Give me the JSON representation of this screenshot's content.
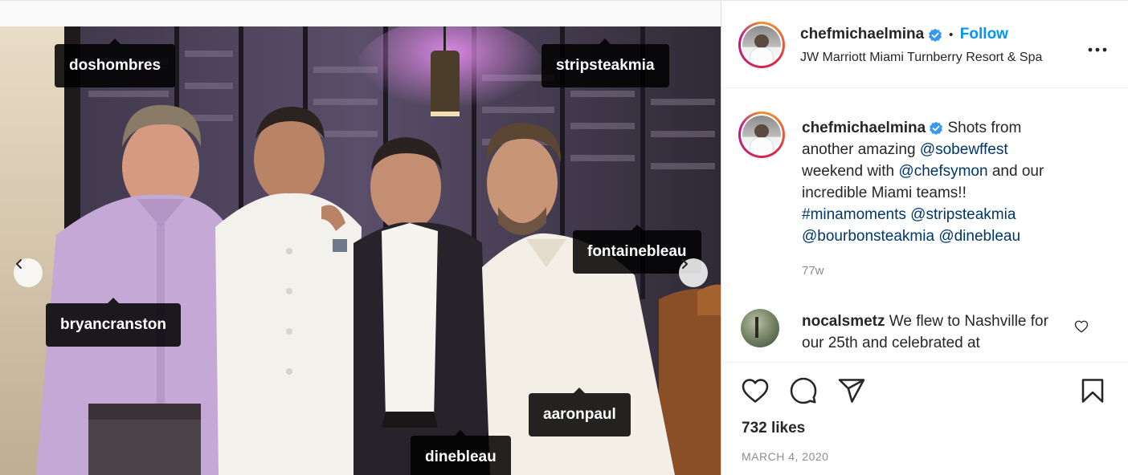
{
  "post": {
    "username": "chefmichaelmina",
    "follow_separator": "•",
    "follow_label": "Follow",
    "location": "JW Marriott Miami Turnberry Resort & Spa",
    "more_label": "•••"
  },
  "photo": {
    "tags": [
      {
        "label": "doshombres"
      },
      {
        "label": "stripsteakmia"
      },
      {
        "label": "fontainebleau"
      },
      {
        "label": "bryancranston"
      },
      {
        "label": "aaronpaul"
      },
      {
        "label": "dinebleau"
      }
    ]
  },
  "caption": {
    "username": "chefmichaelmina",
    "text_1": " Shots from another amazing ",
    "mention_1": "@sobewffest",
    "text_2": " weekend with ",
    "mention_2": "@chefsymon",
    "text_3": " and our incredible Miami teams!! ",
    "tag_1": "#minamoments",
    "text_4": " ",
    "mention_3": "@stripsteakmia",
    "text_5": " ",
    "mention_4": "@bourbonsteakmia",
    "text_6": " ",
    "mention_5": "@dinebleau",
    "time_ago": "77w"
  },
  "comment": {
    "username": "nocalsmetz",
    "text": " We flew to Nashville for our 25th and celebrated at"
  },
  "actions": {
    "likes": "732 likes",
    "date": "MARCH 4, 2020"
  },
  "colors": {
    "accent": "#0095f6",
    "link": "#00376b",
    "muted": "#8e8e8e"
  }
}
